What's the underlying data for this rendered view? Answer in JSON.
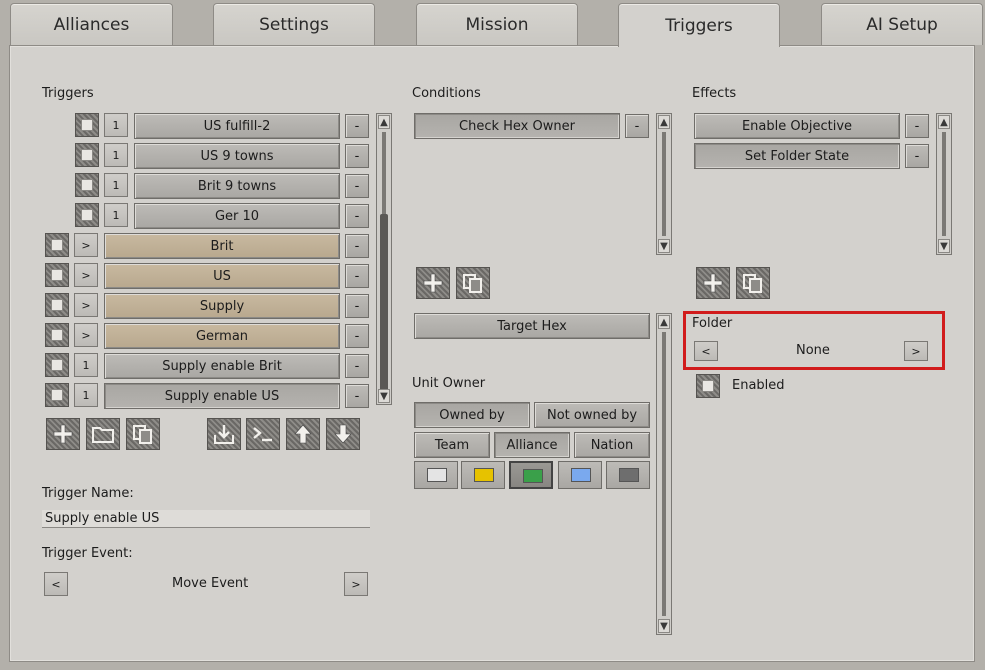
{
  "tabs": [
    "Alliances",
    "Settings",
    "Mission",
    "Triggers",
    "AI Setup"
  ],
  "triggers": {
    "section_label": "Triggers",
    "rows": [
      {
        "count": "1",
        "name": "US fulfill-2",
        "type": "trigger"
      },
      {
        "count": "1",
        "name": "US 9 towns",
        "type": "trigger"
      },
      {
        "count": "1",
        "name": "Brit 9 towns",
        "type": "trigger"
      },
      {
        "count": "1",
        "name": "Ger 10",
        "type": "trigger"
      },
      {
        "count": ">",
        "name": "Brit",
        "type": "folder"
      },
      {
        "count": ">",
        "name": "US",
        "type": "folder"
      },
      {
        "count": ">",
        "name": "Supply",
        "type": "folder"
      },
      {
        "count": ">",
        "name": "German",
        "type": "folder"
      },
      {
        "count": "1",
        "name": "Supply enable Brit",
        "type": "trigger"
      },
      {
        "count": "1",
        "name": "Supply enable US",
        "type": "trigger"
      }
    ],
    "minus_label": "-",
    "name_label": "Trigger Name:",
    "name_value": "Supply enable US",
    "event_label": "Trigger Event:",
    "event_value": "Move Event",
    "prev": "<",
    "next": ">"
  },
  "conditions": {
    "section_label": "Conditions",
    "items": [
      "Check Hex Owner"
    ],
    "minus_label": "-",
    "target_label": "Target Hex",
    "unit_owner_label": "Unit Owner",
    "owned_by": "Owned by",
    "not_owned_by": "Not owned by",
    "team": "Team",
    "alliance": "Alliance",
    "nation": "Nation",
    "colors": [
      "#e4e4e4",
      "#e6c200",
      "#3aa04a",
      "#7aa9ee",
      "#6e6e6e"
    ]
  },
  "effects": {
    "section_label": "Effects",
    "items": [
      "Enable Objective",
      "Set Folder State"
    ],
    "minus_label": "-",
    "folder_label": "Folder",
    "folder_value": "None",
    "prev": "<",
    "next": ">",
    "enabled_label": "Enabled"
  },
  "colors": {
    "background": "#b3b0aa",
    "panel": "#d3d1cd",
    "folder_button": "#c8b9a0",
    "highlight": "#d11c1c"
  }
}
